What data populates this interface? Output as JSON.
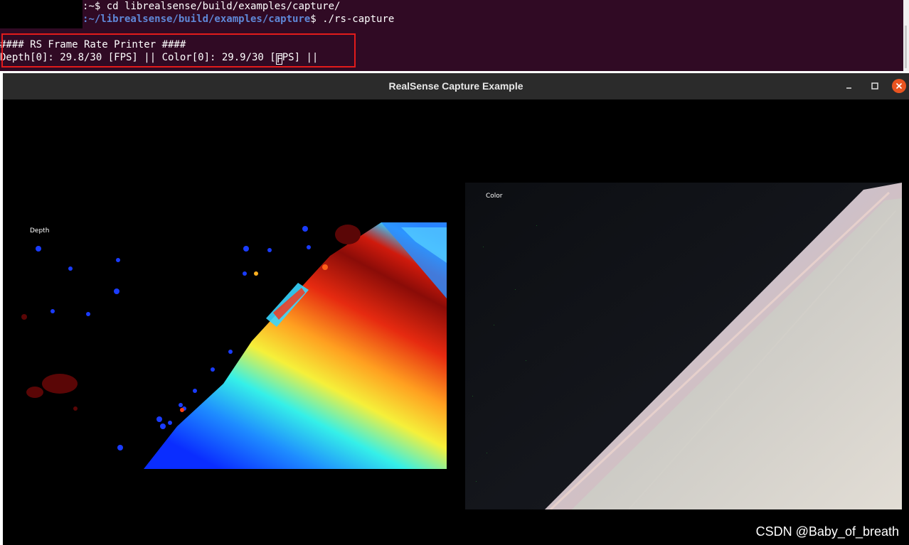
{
  "terminal": {
    "line1_prompt": ":~$",
    "line1_command": " cd librealsense/build/examples/capture/",
    "line2_prompt_path": ":~/librealsense/build/examples/capture",
    "line2_prompt_sym": "$",
    "line2_command": " ./rs-capture",
    "output_line1": "#### RS Frame Rate Printer ####",
    "output_line2_a": "Depth[0]: 29.8/30 [FPS] || Color[0]: 29.9/30 [",
    "output_line2_cursor": "F",
    "output_line2_b": "PS] ||"
  },
  "window": {
    "title": "RealSense Capture Example",
    "minimize_icon": "minimize-icon",
    "maximize_icon": "maximize-icon",
    "close_icon": "close-icon",
    "close_color": "#e95420"
  },
  "views": {
    "depth_label": "Depth",
    "color_label": "Color"
  },
  "watermark": "CSDN @Baby_of_breath"
}
